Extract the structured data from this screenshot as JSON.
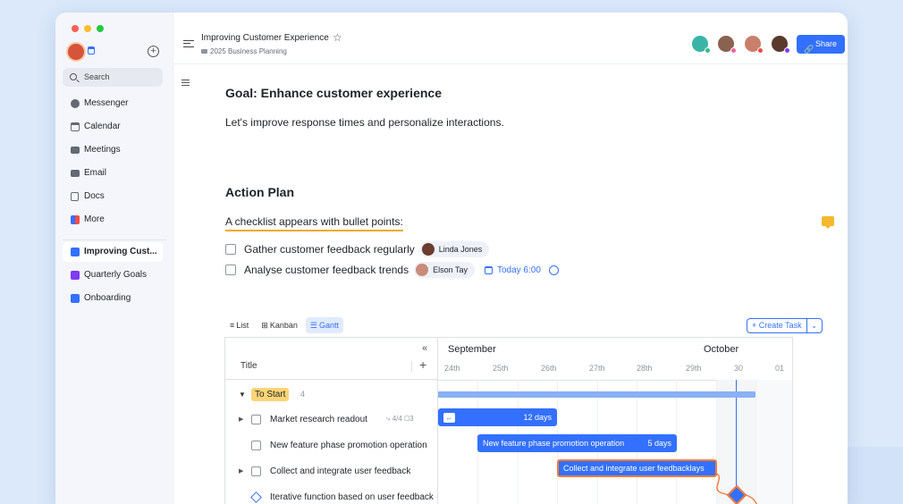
{
  "sidebar": {
    "search_label": "Search",
    "nav": [
      {
        "label": "Messenger",
        "icon": "messenger-icon"
      },
      {
        "label": "Calendar",
        "icon": "calendar-icon"
      },
      {
        "label": "Meetings",
        "icon": "meetings-icon"
      },
      {
        "label": "Email",
        "icon": "email-icon"
      },
      {
        "label": "Docs",
        "icon": "docs-icon"
      },
      {
        "label": "More",
        "icon": "more-apps-icon"
      }
    ],
    "pinned": [
      {
        "label": "Improving Cust...",
        "color": "#3370ff"
      },
      {
        "label": "Quarterly Goals",
        "color": "#7f3bf5"
      },
      {
        "label": "Onboarding",
        "color": "#3370ff"
      }
    ]
  },
  "header": {
    "doc_title": "Improving Customer Experience",
    "breadcrumb": "2025 Business Planning",
    "share_label": "Share",
    "more_label": "···",
    "collaborators": [
      {
        "color": "#3bb4a8",
        "status": "#2ec27e"
      },
      {
        "color": "#8a6250",
        "status": "#f0649b"
      },
      {
        "color": "#c9806b",
        "status": "#f54a45"
      },
      {
        "color": "#5b3a2e",
        "status": "#7f3bf5"
      }
    ]
  },
  "doc": {
    "goal_heading": "Goal: Enhance customer experience",
    "intro": "Let's improve response times and personalize interactions.",
    "plan_heading": "Action Plan",
    "checklist_heading": "A checklist appears with bullet points:",
    "checklist": [
      {
        "text": "Gather customer feedback regularly",
        "assignee": "Linda Jones"
      },
      {
        "text": "Analyse customer feedback trends",
        "assignee": "Elson Tay",
        "due": "Today 6:00"
      }
    ]
  },
  "views": {
    "tabs": [
      {
        "label": "List",
        "icon": "≡",
        "active": false
      },
      {
        "label": "Kanban",
        "icon": "⊞",
        "active": false
      },
      {
        "label": "Gantt",
        "icon": "☰",
        "active": true
      }
    ],
    "create_task_label": "+ Create Task",
    "create_task_dropdown": "⌄"
  },
  "gantt": {
    "title_col": "Title",
    "months": [
      "September",
      "October"
    ],
    "days": [
      "24th",
      "25th",
      "26th",
      "27th",
      "28th",
      "29th",
      "30",
      "01"
    ],
    "group": {
      "label": "To Start",
      "count": "4"
    },
    "rows": [
      {
        "label": "Market research readout",
        "subtasks": "4/4",
        "comments": "3",
        "bar_label": "",
        "duration": "12 days"
      },
      {
        "label": "New feature phase promotion operation",
        "bar_label": "New feature phase promotion operation",
        "duration": "5 days"
      },
      {
        "label": "Collect and integrate user feedback",
        "bar_label": "Collect and integrate user feedbacklays",
        "duration": ""
      },
      {
        "label": "Iterative function based on user feedback",
        "milestone": true
      }
    ]
  }
}
